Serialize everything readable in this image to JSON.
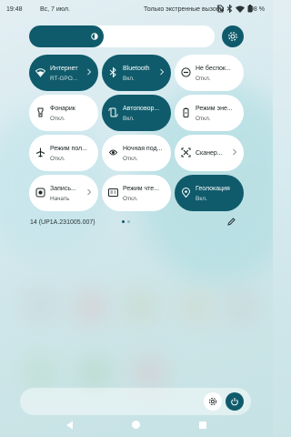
{
  "status_bar": {
    "time": "19:48",
    "date": "Вс, 7 июл.",
    "emergency": "Только экстренные вызовы",
    "battery": "98 %"
  },
  "tiles": [
    {
      "name": "internet",
      "title": "Интернет",
      "subtitle": "RT-GPO...",
      "on": true,
      "chevron": true,
      "icon": "wifi-icon"
    },
    {
      "name": "bluetooth",
      "title": "Bluetooth",
      "subtitle": "Вкл.",
      "on": true,
      "chevron": true,
      "icon": "bluetooth-icon"
    },
    {
      "name": "do-not-disturb",
      "title": "Не беспок...",
      "subtitle": "Откл.",
      "on": false,
      "chevron": false,
      "icon": "dnd-icon"
    },
    {
      "name": "flashlight",
      "title": "Фонарик",
      "subtitle": "Откл.",
      "on": false,
      "chevron": false,
      "icon": "flashlight-icon"
    },
    {
      "name": "auto-rotate",
      "title": "Автоповор...",
      "subtitle": "Вкл.",
      "on": true,
      "chevron": false,
      "icon": "rotate-icon"
    },
    {
      "name": "battery-saver",
      "title": "Режим эне...",
      "subtitle": "Откл.",
      "on": false,
      "chevron": false,
      "icon": "battery-saver-icon"
    },
    {
      "name": "airplane-mode",
      "title": "Режим пол...",
      "subtitle": "Откл.",
      "on": false,
      "chevron": false,
      "icon": "airplane-icon"
    },
    {
      "name": "night-light",
      "title": "Ночная под...",
      "subtitle": "Откл.",
      "on": false,
      "chevron": false,
      "icon": "night-light-icon"
    },
    {
      "name": "qr-scanner",
      "title": "Сканер...",
      "subtitle": "",
      "on": false,
      "chevron": true,
      "icon": "scanner-icon"
    },
    {
      "name": "screen-record",
      "title": "Запись...",
      "subtitle": "Начать",
      "on": false,
      "chevron": true,
      "icon": "record-icon"
    },
    {
      "name": "reading-mode",
      "title": "Режим чте...",
      "subtitle": "Откл.",
      "on": false,
      "chevron": false,
      "icon": "reading-icon"
    },
    {
      "name": "location",
      "title": "Геолокация",
      "subtitle": "Вкл.",
      "on": true,
      "chevron": false,
      "icon": "location-icon"
    }
  ],
  "build_number": "14 (UP1A.231005.007)",
  "brightness_level": 0.4,
  "colors": {
    "accent": "#0f5b6b",
    "tile_off": "#ffffff"
  }
}
